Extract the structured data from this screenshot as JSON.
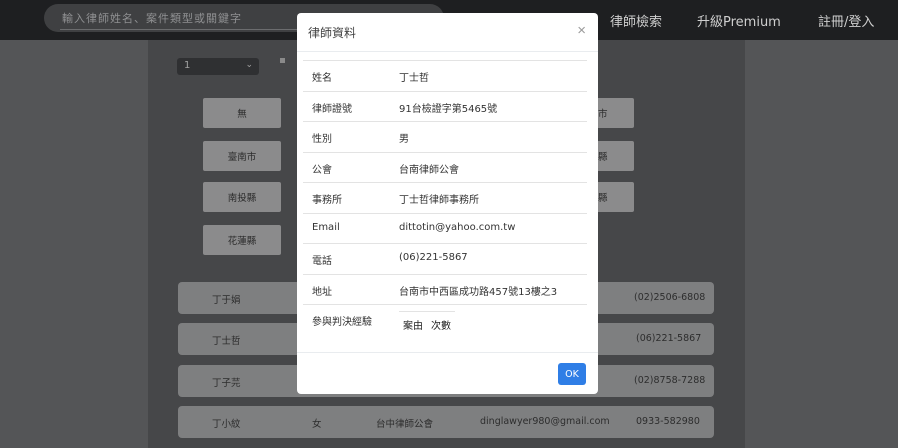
{
  "header": {
    "search_placeholder": "輸入律師姓名、案件類型或關鍵字",
    "nav": {
      "lawyer_search": "律師檢索",
      "premium": "升級Premium",
      "login": "註冊/登入"
    }
  },
  "pagination": {
    "selected": "1"
  },
  "regions": {
    "left": [
      "無",
      "臺南市",
      "南投縣",
      "花蓮縣"
    ],
    "right_fragments": [
      "市",
      "縣",
      "縣"
    ]
  },
  "rows": [
    {
      "name": "丁于娟",
      "phone": "(02)2506-6808"
    },
    {
      "name": "丁士哲",
      "phone": "(06)221-5867"
    },
    {
      "name": "丁子芫",
      "phone": "(02)8758-7288"
    },
    {
      "name": "丁小紋",
      "gender": "女",
      "association": "台中律師公會",
      "email": "dinglawyer980@gmail.com",
      "phone": "0933-582980"
    }
  ],
  "modal": {
    "title": "律師資料",
    "close": "×",
    "fields": [
      {
        "label": "姓名",
        "value": "丁士哲"
      },
      {
        "label": "律師證號",
        "value": "91台檢證字第5465號"
      },
      {
        "label": "性別",
        "value": "男"
      },
      {
        "label": "公會",
        "value": "台南律師公會"
      },
      {
        "label": "事務所",
        "value": "丁士哲律師事務所"
      },
      {
        "label": "Email",
        "value": "dittotin@yahoo.com.tw"
      },
      {
        "label": "電話",
        "value": "(06)221-5867"
      },
      {
        "label": "地址",
        "value": "台南市中西區成功路457號13樓之3"
      }
    ],
    "cases": {
      "label": "參與判決經驗",
      "col_reason": "案由",
      "col_count": "次數"
    },
    "ok": "OK"
  },
  "colors": {
    "accent": "#2f7ee6",
    "topbar": "#1e1f21",
    "overlay": "#545557"
  }
}
